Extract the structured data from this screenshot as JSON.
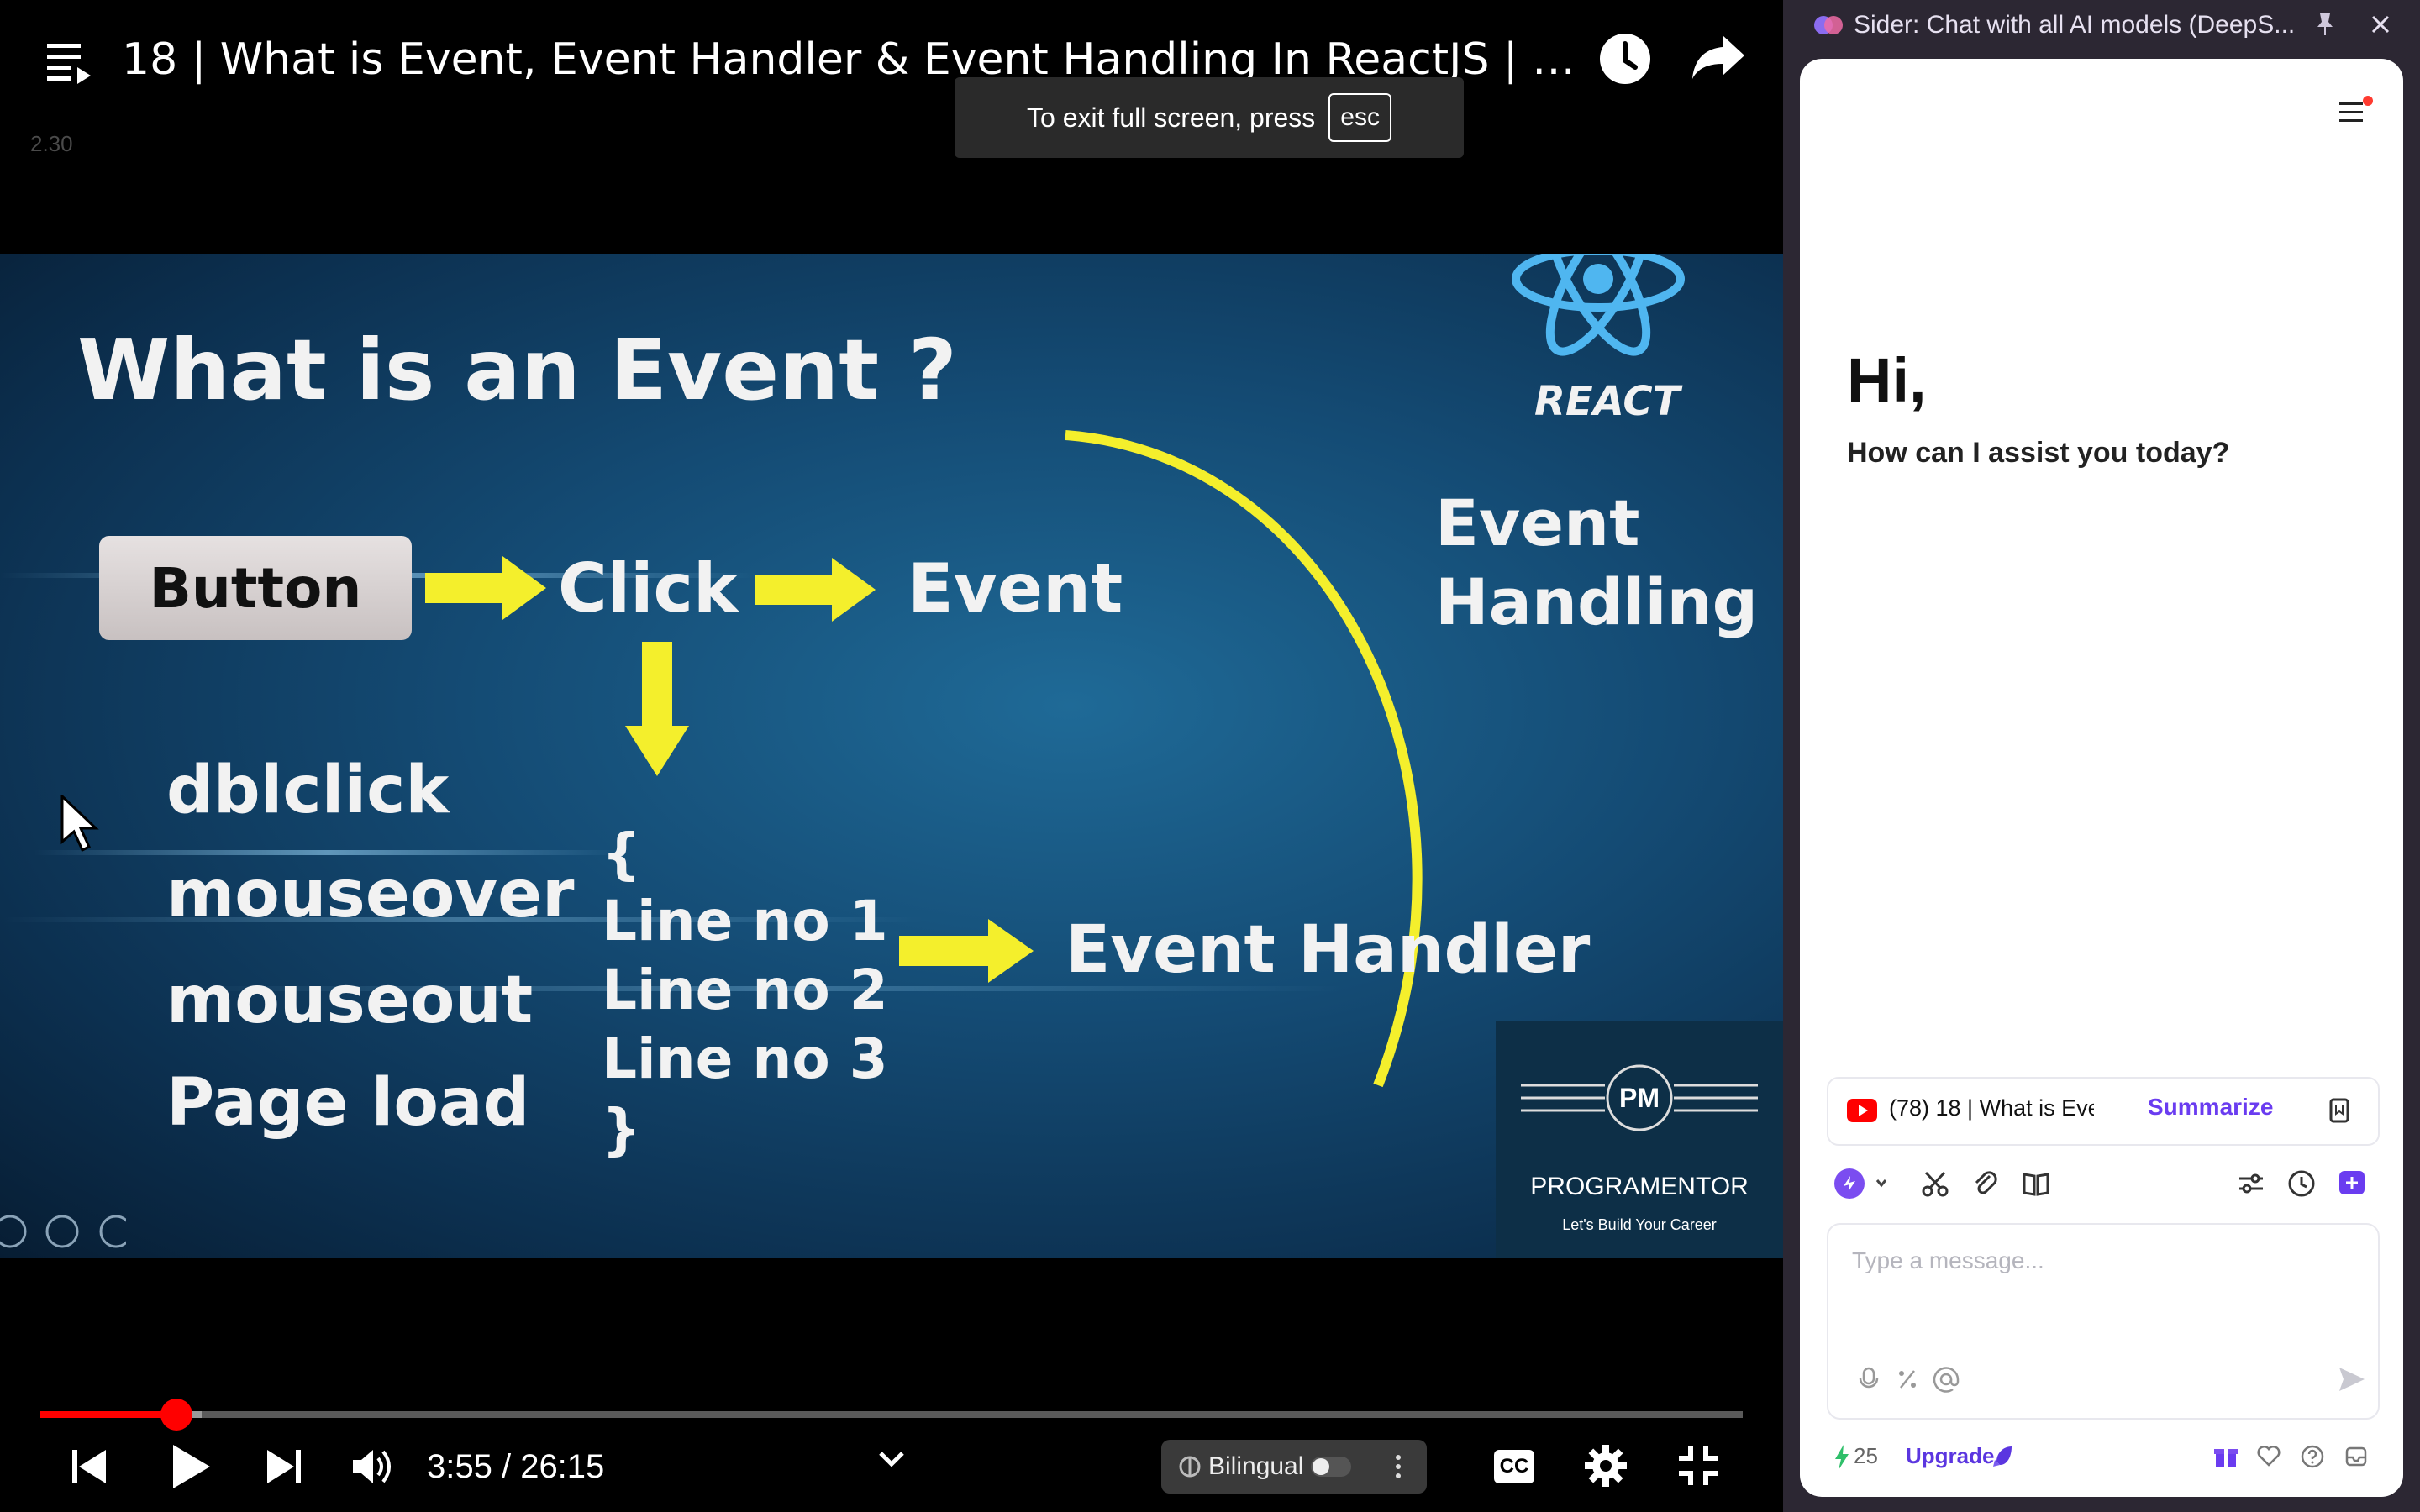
{
  "player": {
    "title": "18 | What is Event, Event Handler & Event Handling In ReactJS | Event H...",
    "speed": "2.30",
    "fullscreen_toast": {
      "text": "To exit full screen, press",
      "key": "esc"
    },
    "time": "3:55 / 26:15",
    "progress": {
      "played_fraction": 0.08,
      "buffered_fraction": 0.095
    },
    "bilingual": {
      "label": "Bilingual",
      "enabled": false
    },
    "cc_label": "CC"
  },
  "slide": {
    "heading": "What is an Event ?",
    "react_label": "REACT",
    "button_label": "Button",
    "click_label": "Click",
    "event_label": "Event",
    "handling_label_1": "Event",
    "handling_label_2": "Handling",
    "event_types": [
      "dblclick",
      "mouseover",
      "mouseout",
      "Page load"
    ],
    "brace_open": "{",
    "code_lines": [
      "Line no 1",
      "Line no 2",
      "Line no 3"
    ],
    "brace_close": "}",
    "handler_label": "Event Handler",
    "brand": {
      "initials": "PM",
      "name": "PROGRAMENTOR",
      "tagline": "Let's Build Your Career"
    }
  },
  "sider": {
    "title": "Sider: Chat with all AI models (DeepS...",
    "greeting": "Hi,",
    "subgreeting": "How can I assist you today?",
    "context": {
      "title": "(78) 18 | What is Even",
      "summarize_label": "Summarize"
    },
    "message_placeholder": "Type a message...",
    "credits": "25",
    "upgrade_label": "Upgrade"
  }
}
